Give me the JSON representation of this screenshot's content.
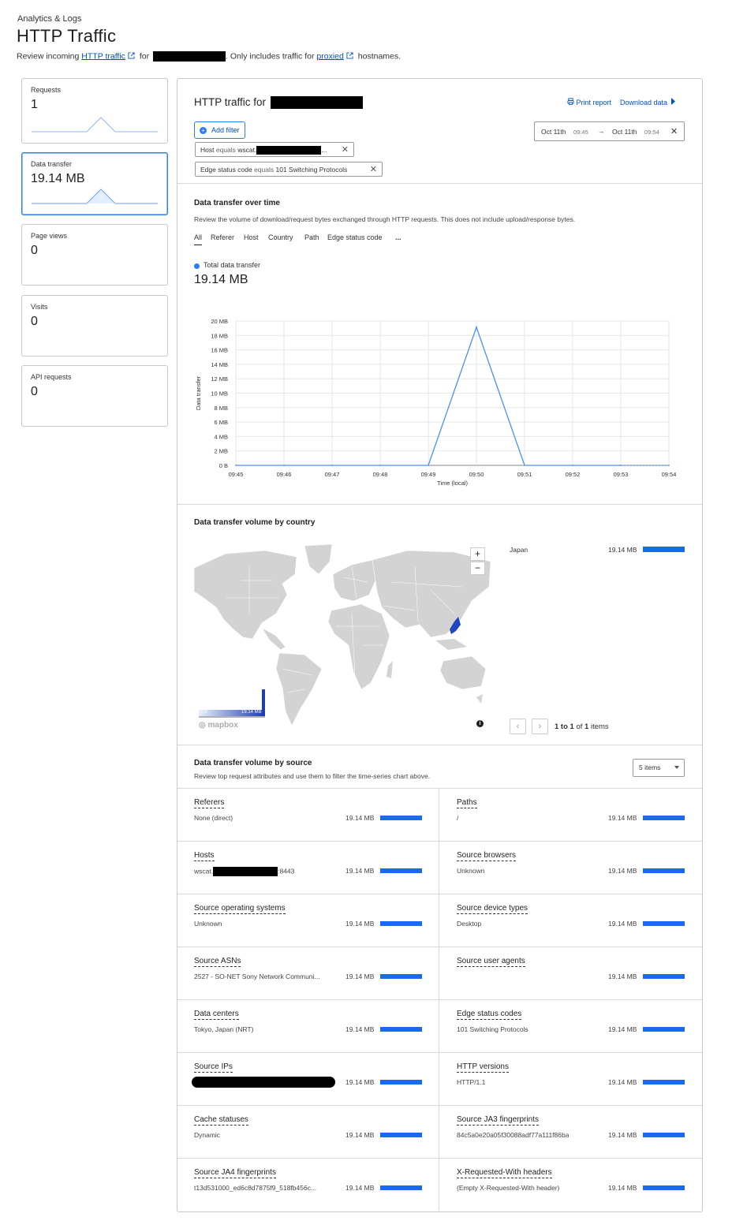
{
  "header": {
    "breadcrumb": "Analytics & Logs",
    "title": "HTTP Traffic",
    "subtitle": {
      "prefix": "Review incoming",
      "http_link": "HTTP traffic",
      "for_text": "for",
      "mid": ". Only includes traffic for",
      "proxied_link": "proxied",
      "suffix": "hostnames."
    }
  },
  "metrics": [
    {
      "label": "Requests",
      "value": "1"
    },
    {
      "label": "Data transfer",
      "value": "19.14 MB"
    },
    {
      "label": "Page views",
      "value": "0"
    },
    {
      "label": "Visits",
      "value": "0"
    },
    {
      "label": "API requests",
      "value": "0"
    }
  ],
  "panel": {
    "title": "HTTP traffic for",
    "print_report": "Print report",
    "download_data": "Download data",
    "add_filter": "Add filter",
    "filters": [
      {
        "field": "Host",
        "op": "equals",
        "value": "wscat.",
        "suffix": "..."
      },
      {
        "field": "Edge status code",
        "op": "equals",
        "value": "101 Switching Protocols",
        "suffix": ""
      }
    ],
    "date_range": {
      "from_date": "Oct 11th",
      "from_time": "09:45",
      "arrow": "→",
      "to_date": "Oct 11th",
      "to_time": "09:54"
    }
  },
  "time_section": {
    "title": "Data transfer over time",
    "desc": "Review the volume of download/request bytes exchanged through HTTP requests. This does not include upload/response bytes.",
    "tabs": [
      "All",
      "Referer",
      "Host",
      "Country",
      "Path",
      "Edge status code",
      "..."
    ],
    "legend": "Total data transfer",
    "total": "19.14 MB"
  },
  "chart_data": {
    "type": "line",
    "xlabel": "Time (local)",
    "ylabel": "Data transfer",
    "x": [
      "09:45",
      "09:46",
      "09:47",
      "09:48",
      "09:49",
      "09:50",
      "09:51",
      "09:52",
      "09:53",
      "09:54"
    ],
    "y_ticks": [
      "0 B",
      "2 MB",
      "4 MB",
      "6 MB",
      "8 MB",
      "10 MB",
      "12 MB",
      "14 MB",
      "16 MB",
      "18 MB",
      "20 MB"
    ],
    "ylim": [
      0,
      20
    ],
    "series": [
      {
        "values": [
          0,
          0,
          0,
          0,
          0,
          19.14,
          0,
          0,
          0,
          0
        ],
        "color": "#4c8ef7"
      }
    ],
    "grid": true
  },
  "country_section": {
    "title": "Data transfer volume by country",
    "rows": [
      {
        "name": "Japan",
        "value": "19.14 MB"
      }
    ],
    "scale_min": "0 B",
    "scale_max": "19.14 MB",
    "map_attribution": "mapbox",
    "zoom_in": "+",
    "zoom_out": "−",
    "info": "i",
    "pager_prev": "‹",
    "pager_next": "›",
    "pager_range": "1 to 1",
    "pager_of": "of",
    "pager_total": "1",
    "pager_items": "items"
  },
  "source_section": {
    "title": "Data transfer volume by source",
    "desc": "Review top request attributes and use them to filter the time-series chart above.",
    "items_select": "5 items",
    "cells": [
      {
        "title": "Referers",
        "value": "None (direct)",
        "amount": "19.14 MB"
      },
      {
        "title": "Paths",
        "value": "/",
        "amount": "19.14 MB"
      },
      {
        "title": "Hosts",
        "value": "wscat.",
        "value_suffix": ":8443",
        "amount": "19.14 MB"
      },
      {
        "title": "Source browsers",
        "value": "Unknown",
        "amount": "19.14 MB"
      },
      {
        "title": "Source operating systems",
        "value": "Unknown",
        "amount": "19.14 MB"
      },
      {
        "title": "Source device types",
        "value": "Desktop",
        "amount": "19.14 MB"
      },
      {
        "title": "Source ASNs",
        "value": "2527 - SO-NET Sony Network Communi...",
        "amount": "19.14 MB"
      },
      {
        "title": "Source user agents",
        "value": "",
        "amount": "19.14 MB"
      },
      {
        "title": "Data centers",
        "value": "Tokyo, Japan (NRT)",
        "amount": "19.14 MB"
      },
      {
        "title": "Edge status codes",
        "value": "101 Switching Protocols",
        "amount": "19.14 MB"
      },
      {
        "title": "Source IPs",
        "value": "",
        "amount": "19.14 MB"
      },
      {
        "title": "HTTP versions",
        "value": "HTTP/1.1",
        "amount": "19.14 MB"
      },
      {
        "title": "Cache statuses",
        "value": "Dynamic",
        "amount": "19.14 MB"
      },
      {
        "title": "Source JA3 fingerprints",
        "value": "84c5a0e20a05f30088adf77a111f86ba",
        "amount": "19.14 MB"
      },
      {
        "title": "Source JA4 fingerprints",
        "value": "t13d531000_ed6c8d7875f9_518fb456c...",
        "amount": "19.14 MB"
      },
      {
        "title": "X-Requested-With headers",
        "value": "(Empty X-Requested-With header)",
        "amount": "19.14 MB"
      }
    ]
  },
  "colors": {
    "accent": "#2c7cf6",
    "bar": "#1a6af0",
    "link": "#0051c3",
    "map_land": "#d3d3d3"
  },
  "icons": [
    "external-link-icon",
    "printer-icon",
    "play-arrow-icon",
    "plus-circle-icon",
    "close-icon",
    "arrow-right-icon",
    "chevron-left-icon",
    "chevron-right-icon",
    "info-icon",
    "caret-down-icon"
  ]
}
